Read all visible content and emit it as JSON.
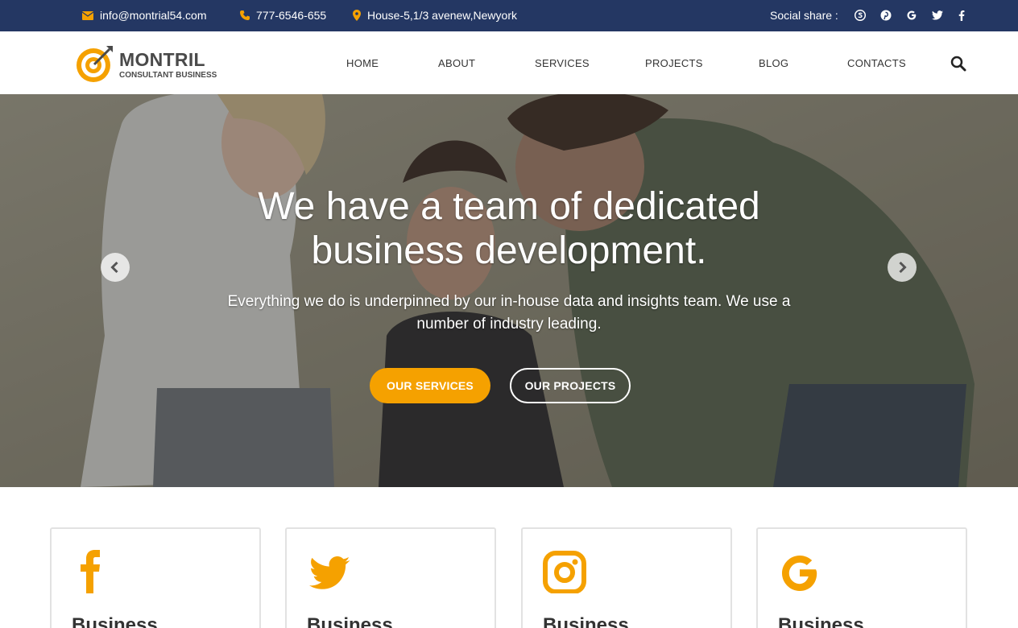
{
  "topbar": {
    "email": "info@montrial54.com",
    "phone": "777-6546-655",
    "address": "House-5,1/3 avenew,Newyork",
    "social_label": "Social share :",
    "social_icons": [
      "skype-icon",
      "pinterest-icon",
      "google-icon",
      "twitter-icon",
      "facebook-icon"
    ]
  },
  "brand": {
    "name": "MONTRIL",
    "tagline": "CONSULTANT BUSINESS",
    "accent": "#f5a100",
    "dark": "#243763"
  },
  "nav": {
    "items": [
      "HOME",
      "ABOUT",
      "SERVICES",
      "PROJECTS",
      "BLOG",
      "CONTACTS"
    ]
  },
  "hero": {
    "title_line1": "We have a team of dedicated",
    "title_line2": "business development.",
    "subtitle": "Everything we do is underpinned by our in-house data and insights team. We use a number of industry leading.",
    "primary_button": "OUR SERVICES",
    "secondary_button": "OUR PROJECTS"
  },
  "cards": [
    {
      "icon": "facebook-icon",
      "title": "Business"
    },
    {
      "icon": "twitter-icon",
      "title": "Business"
    },
    {
      "icon": "instagram-icon",
      "title": "Business"
    },
    {
      "icon": "google-icon",
      "title": "Business"
    }
  ]
}
